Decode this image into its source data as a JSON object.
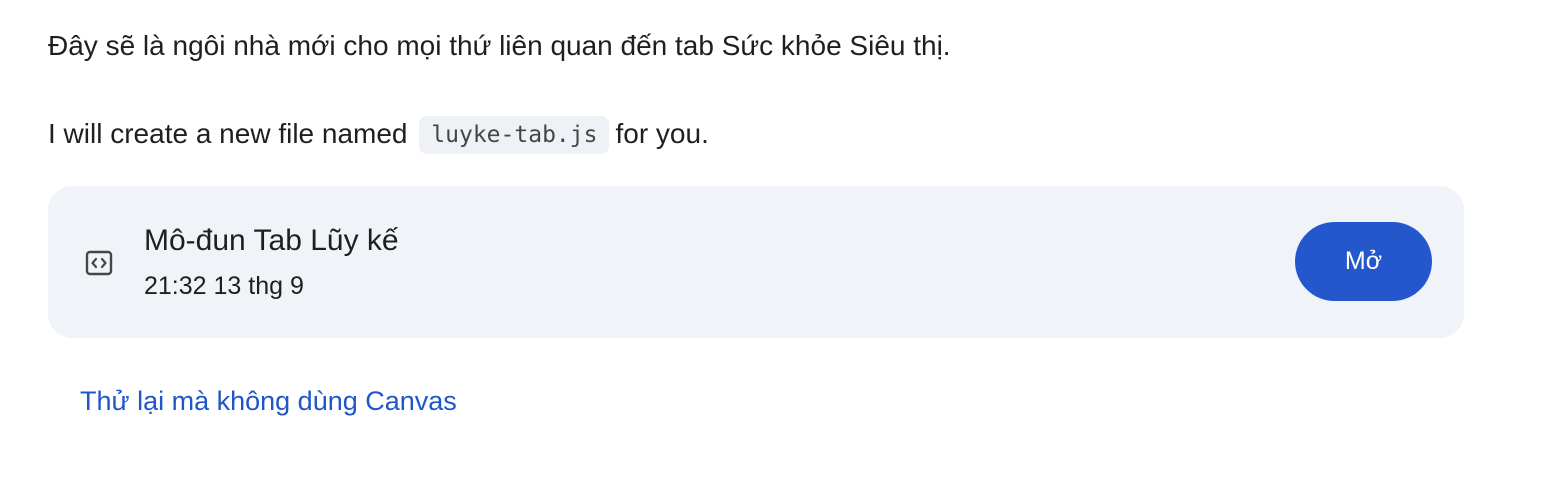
{
  "message": {
    "paragraph_1": "Đây sẽ là ngôi nhà mới cho mọi thứ liên quan đến tab Sức khỏe Siêu thị.",
    "paragraph_2_before": "I will create a new file named",
    "paragraph_2_code": "luyke-tab.js",
    "paragraph_2_after": "for you."
  },
  "file_card": {
    "icon": "code-file-icon",
    "title": "Mô-đun Tab Lũy kế",
    "timestamp": "21:32 13 thg 9",
    "open_label": "Mở"
  },
  "retry_link": "Thử lại mà không dùng Canvas",
  "colors": {
    "card_background": "#f0f4f9",
    "button": "#2557cc",
    "link": "#1f57c8",
    "code_chip": "#eef1f5"
  }
}
